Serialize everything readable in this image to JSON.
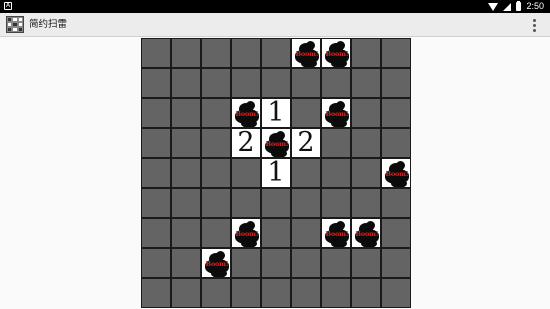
{
  "status_bar": {
    "notification_icon": "android-notification-icon",
    "time": "2:50"
  },
  "app_bar": {
    "title": "简约扫雷",
    "icon": "minesweeper-app-icon",
    "menu_icon": "overflow-menu-icon"
  },
  "board": {
    "rows": 9,
    "cols": 9,
    "bomb_label": "Boom!",
    "cells": [
      [
        "",
        "",
        "",
        "",
        "",
        "B",
        "B",
        "",
        ""
      ],
      [
        "",
        "",
        "",
        "",
        "",
        "",
        "",
        "",
        ""
      ],
      [
        "",
        "",
        "",
        "B",
        "1",
        "",
        "B",
        "",
        ""
      ],
      [
        "",
        "",
        "",
        "2",
        "B",
        "2",
        "",
        "",
        ""
      ],
      [
        "",
        "",
        "",
        "",
        "1",
        "",
        "",
        "",
        "B"
      ],
      [
        "",
        "",
        "",
        "",
        "",
        "",
        "",
        "",
        ""
      ],
      [
        "",
        "",
        "",
        "B",
        "",
        "",
        "B",
        "B",
        ""
      ],
      [
        "",
        "",
        "B",
        "",
        "",
        "",
        "",
        "",
        ""
      ],
      [
        "",
        "",
        "",
        "",
        "",
        "",
        "",
        "",
        ""
      ]
    ]
  },
  "colors": {
    "covered_cell": "#646464",
    "open_cell": "#ffffff",
    "bomb_text": "#e02020",
    "grid_line": "#1a1a1a"
  }
}
